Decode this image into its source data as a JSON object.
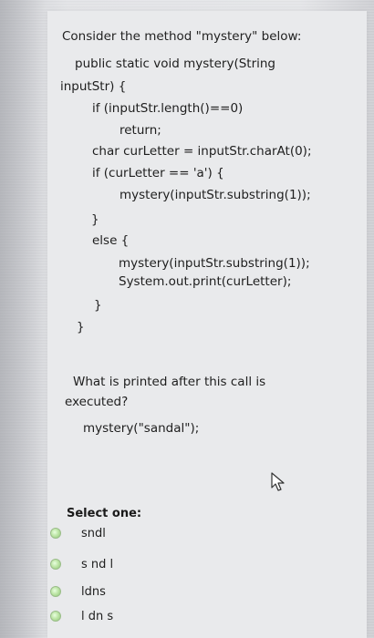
{
  "question": {
    "intro": "Consider the method \"mystery\" below:",
    "code_lines": [
      "public static void mystery(String",
      "inputStr) {",
      "if (inputStr.length()==0)",
      "return;",
      "char curLetter = inputStr.charAt(0);",
      "if (curLetter == 'a') {",
      "mystery(inputStr.substring(1));",
      "}",
      "else {",
      "mystery(inputStr.substring(1));",
      "System.out.print(curLetter);",
      "}",
      "}"
    ],
    "prompt_line1": "What is printed after this call is",
    "prompt_line2": "executed?",
    "call": "mystery(\"sandal\");"
  },
  "answers": {
    "select_label": "Select one:",
    "options": [
      "sndl",
      "s nd l",
      "ldns",
      "l dn s"
    ]
  },
  "colors": {
    "radio": "#a8d68e",
    "background": "#e6e7ea"
  },
  "icons": {
    "cursor": "mouse-pointer-icon"
  }
}
